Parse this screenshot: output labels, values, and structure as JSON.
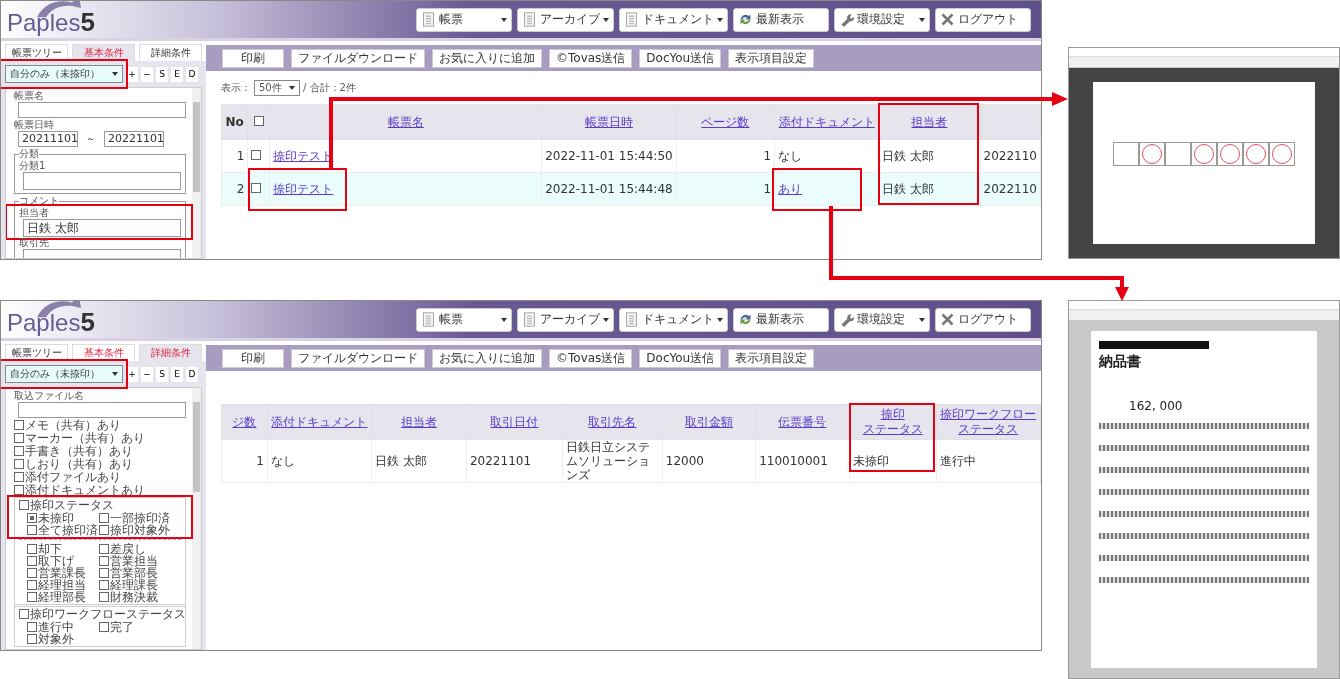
{
  "panels": [
    {
      "kind": "list",
      "header": {
        "logo": "Paples",
        "logo_number": "5",
        "menu": [
          {
            "label": "帳票",
            "dropdown": true
          },
          {
            "label": "アーカイブ",
            "dropdown": true
          },
          {
            "label": "ドキュメント",
            "dropdown": true
          },
          {
            "label": "最新表示",
            "dropdown": false
          },
          {
            "label": "環境設定",
            "dropdown": true
          },
          {
            "label": "ログアウト",
            "dropdown": false
          }
        ]
      },
      "sidebar": {
        "tabs": [
          {
            "label": "帳票ツリー",
            "selected": false,
            "flagged": false
          },
          {
            "label": "基本条件",
            "selected": true,
            "flagged": true
          },
          {
            "label": "詳細条件",
            "selected": false,
            "flagged": false
          }
        ],
        "preset": {
          "value": "自分のみ（未捺印）",
          "highlighted": true
        },
        "preset_buttons": [
          "+",
          "−",
          "S",
          "E",
          "D"
        ],
        "filters": [
          {
            "kind": "text",
            "label": "帳票名"
          },
          {
            "kind": "range",
            "label": "帳票日時",
            "from": "20211101",
            "separator": "～",
            "to": "20221101"
          },
          {
            "kind": "group",
            "legend": "分類",
            "items": [
              {
                "label": "分類1",
                "highlighted": false
              }
            ]
          },
          {
            "kind": "group",
            "legend": "コメント",
            "items": [
              {
                "label": "担当者",
                "value": "日鉄 太郎",
                "highlighted": true
              },
              {
                "label": "取引先",
                "highlighted": false
              }
            ]
          }
        ]
      },
      "actions": [
        "印刷",
        "ファイルダウンロード",
        "お気に入りに追加",
        "©Tovas送信",
        "DocYou送信",
        "表示項目設定"
      ],
      "paging": {
        "label": "表示：",
        "page_size": "50件",
        "total": "/ 合計：2件"
      },
      "table": {
        "columns": [
          {
            "kind": "num",
            "label": "No",
            "highlighted": false
          },
          {
            "kind": "check",
            "checked": false,
            "highlighted": false
          },
          {
            "kind": "link",
            "label": "帳票名",
            "highlighted": false
          },
          {
            "kind": "link",
            "label": "帳票日時",
            "highlighted": false
          },
          {
            "kind": "link",
            "label": "ページ数",
            "highlighted": false
          },
          {
            "kind": "link",
            "label": "添付ドキュメント",
            "highlighted": false
          },
          {
            "kind": "link",
            "label": "担当者",
            "highlighted": true
          },
          {
            "kind": "blank",
            "highlighted": false
          }
        ],
        "rows": [
          {
            "selected": false,
            "cells": [
              {
                "kind": "num",
                "text": "1",
                "highlighted": false
              },
              {
                "kind": "check",
                "checked": false,
                "highlighted": false
              },
              {
                "kind": "link",
                "text": "捺印テスト",
                "highlighted": false
              },
              {
                "kind": "text",
                "text": "2022-11-01 15:44:50",
                "highlighted": false
              },
              {
                "kind": "num",
                "text": "1",
                "highlighted": false
              },
              {
                "kind": "text",
                "text": "なし",
                "highlighted": false
              },
              {
                "kind": "text",
                "text": "日鉄 太郎",
                "highlighted": false
              },
              {
                "kind": "text",
                "text": "2022110",
                "highlighted": false
              }
            ]
          },
          {
            "selected": true,
            "cells": [
              {
                "kind": "num",
                "text": "2",
                "highlighted": false
              },
              {
                "kind": "check",
                "checked": false,
                "highlighted": false
              },
              {
                "kind": "link",
                "text": "捺印テスト",
                "highlighted": true
              },
              {
                "kind": "text",
                "text": "2022-11-01 15:44:48",
                "highlighted": false
              },
              {
                "kind": "num",
                "text": "1",
                "highlighted": false
              },
              {
                "kind": "link",
                "text": "あり",
                "highlighted": true
              },
              {
                "kind": "text",
                "text": "日鉄 太郎",
                "highlighted": false
              },
              {
                "kind": "text",
                "text": "2022110",
                "highlighted": false
              }
            ]
          }
        ]
      }
    },
    {
      "kind": "detail",
      "header": {
        "logo": "Paples",
        "logo_number": "5",
        "menu": [
          {
            "label": "帳票",
            "dropdown": true
          },
          {
            "label": "アーカイブ",
            "dropdown": true
          },
          {
            "label": "ドキュメント",
            "dropdown": true
          },
          {
            "label": "最新表示",
            "dropdown": false
          },
          {
            "label": "環境設定",
            "dropdown": true
          },
          {
            "label": "ログアウト",
            "dropdown": false
          }
        ]
      },
      "sidebar": {
        "tabs": [
          {
            "label": "帳票ツリー",
            "selected": false,
            "flagged": false
          },
          {
            "label": "基本条件",
            "selected": false,
            "flagged": true
          },
          {
            "label": "詳細条件",
            "selected": true,
            "flagged": true
          }
        ],
        "preset": {
          "value": "自分のみ（未捺印）",
          "highlighted": true
        },
        "preset_buttons": [
          "+",
          "−",
          "S",
          "E",
          "D"
        ],
        "filters": [
          {
            "kind": "text",
            "label": "取込ファイル名"
          },
          {
            "kind": "check",
            "label": "メモ（共有）あり",
            "checked": false
          },
          {
            "kind": "check",
            "label": "マーカー（共有）あり",
            "checked": false
          },
          {
            "kind": "check",
            "label": "手書き（共有）あり",
            "checked": false
          },
          {
            "kind": "check",
            "label": "しおり（共有）あり",
            "checked": false
          },
          {
            "kind": "check",
            "label": "添付ファイルあり",
            "checked": false
          },
          {
            "kind": "check",
            "label": "添付ドキュメントあり",
            "checked": false
          },
          {
            "kind": "checkgroup",
            "label": "捺印ステータス",
            "checked": false,
            "highlighted": true,
            "options": [
              {
                "label": "未捺印",
                "checked": true
              },
              {
                "label": "一部捺印済",
                "checked": false
              },
              {
                "label": "全て捺印済",
                "checked": false
              },
              {
                "label": "捺印対象外",
                "checked": false
              }
            ],
            "more_options": [
              {
                "label": "却下",
                "checked": false
              },
              {
                "label": "差戻し",
                "checked": false
              },
              {
                "label": "取下げ",
                "checked": false
              },
              {
                "label": "営業担当",
                "checked": false
              },
              {
                "label": "営業課長",
                "checked": false
              },
              {
                "label": "営業部長",
                "checked": false
              },
              {
                "label": "経理担当",
                "checked": false
              },
              {
                "label": "経理課長",
                "checked": false
              },
              {
                "label": "経理部長",
                "checked": false
              },
              {
                "label": "財務決裁",
                "checked": false
              }
            ]
          },
          {
            "kind": "checkgroup",
            "label": "捺印ワークフローステータス",
            "checked": false,
            "highlighted": false,
            "options": [
              {
                "label": "進行中",
                "checked": false
              },
              {
                "label": "完了",
                "checked": false
              },
              {
                "label": "対象外",
                "checked": false
              }
            ]
          }
        ]
      },
      "actions": [
        "印刷",
        "ファイルダウンロード",
        "お気に入りに追加",
        "©Tovas送信",
        "DocYou送信",
        "表示項目設定"
      ],
      "table": {
        "columns": [
          {
            "kind": "link",
            "label": "ジ数",
            "highlighted": false
          },
          {
            "kind": "link",
            "label": "添付ドキュメント",
            "highlighted": false
          },
          {
            "kind": "link",
            "label": "担当者",
            "highlighted": false
          },
          {
            "kind": "link",
            "label": "取引日付",
            "highlighted": false
          },
          {
            "kind": "link",
            "label": "取引先名",
            "highlighted": false
          },
          {
            "kind": "link",
            "label": "取引金額",
            "highlighted": false
          },
          {
            "kind": "link",
            "label": "伝票番号",
            "highlighted": false
          },
          {
            "kind": "link",
            "label": "捺印",
            "label_2": "ステータス",
            "highlighted": true
          },
          {
            "kind": "link",
            "label": "捺印ワークフロー",
            "label_2": "ステータス",
            "highlighted": false
          }
        ],
        "rows": [
          {
            "selected": false,
            "cells": [
              {
                "kind": "num",
                "text": "1"
              },
              {
                "kind": "text",
                "text": "なし"
              },
              {
                "kind": "text",
                "text": "日鉄 太郎"
              },
              {
                "kind": "text",
                "text": "20221101"
              },
              {
                "kind": "text",
                "text": "日鉄日立システムソリューションズ"
              },
              {
                "kind": "text",
                "text": "12000"
              },
              {
                "kind": "text",
                "text": "110010001"
              },
              {
                "kind": "text",
                "text": "未捺印"
              },
              {
                "kind": "text",
                "text": "進行中"
              }
            ]
          }
        ]
      }
    }
  ],
  "previews": [
    {
      "kind": "print"
    },
    {
      "kind": "viewer",
      "page": {
        "title": "納品書",
        "amount": "162, 000"
      }
    }
  ]
}
